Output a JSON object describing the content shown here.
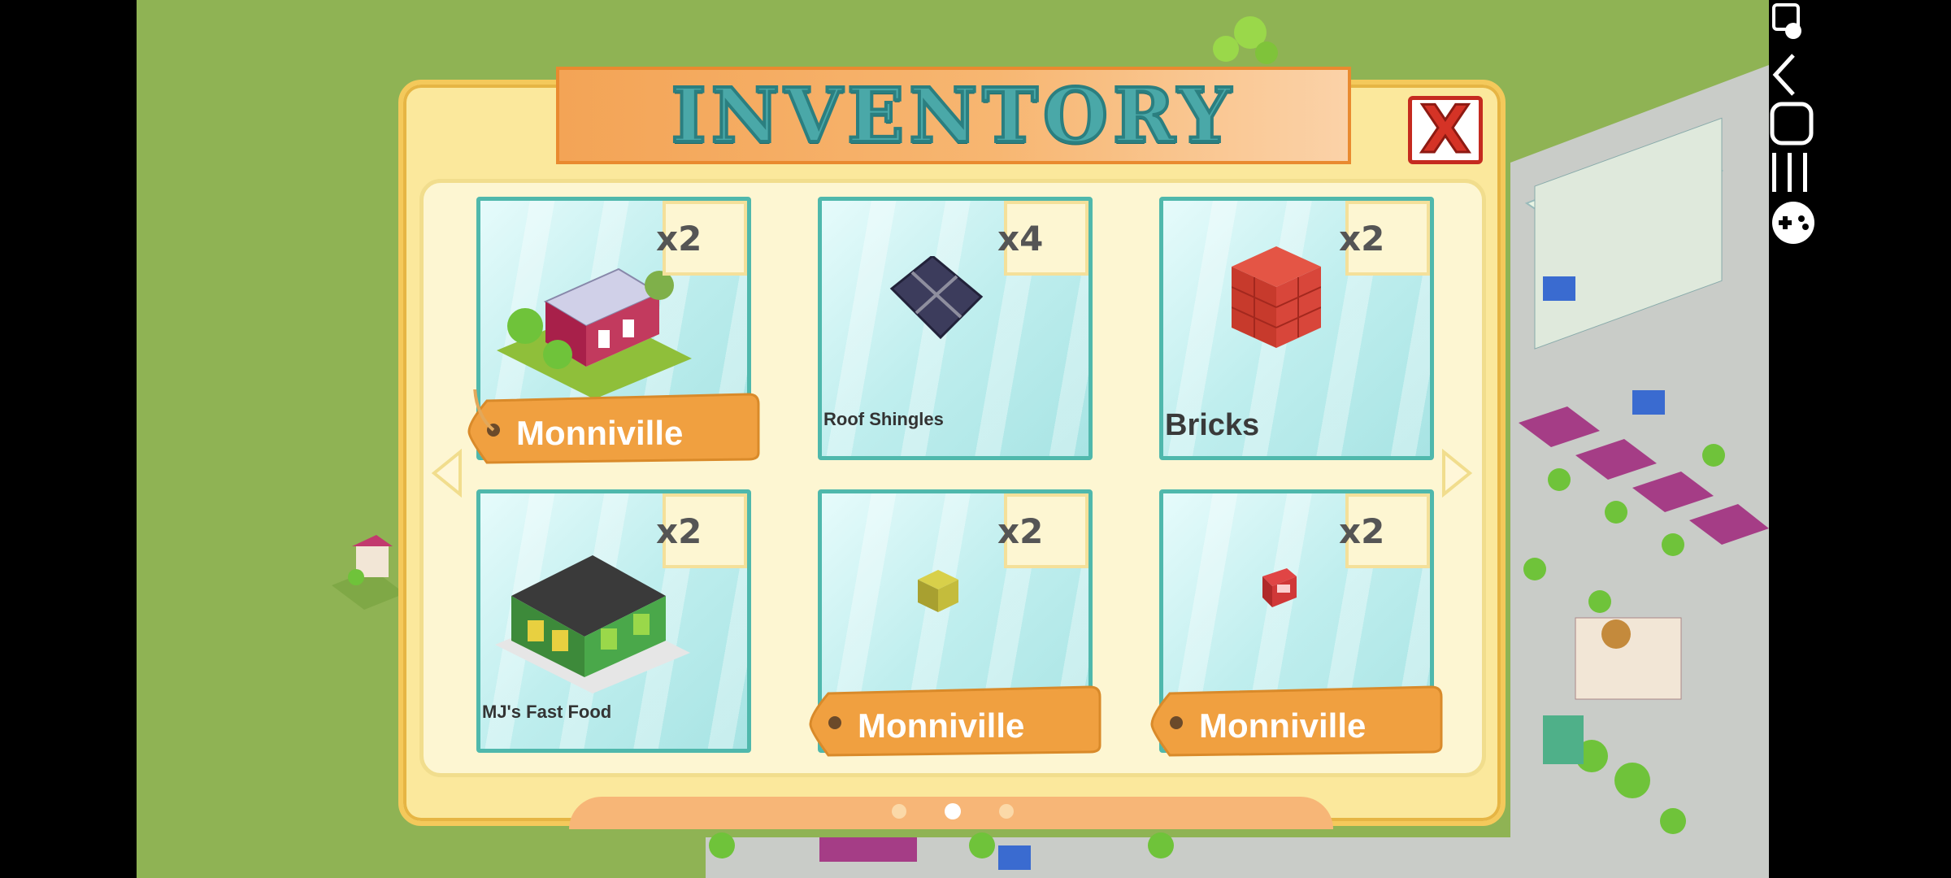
{
  "window": {
    "title": "INVENTORY"
  },
  "close_button": {
    "label": "X",
    "icon": "close-icon"
  },
  "grid": {
    "items": [
      {
        "name": "Monniville",
        "count": "x2",
        "label_style": "tag",
        "icon": "house-icon"
      },
      {
        "name": "Roof Shingles",
        "count": "x4",
        "label_style": "small",
        "icon": "roof-shingles-icon"
      },
      {
        "name": "Bricks",
        "count": "x2",
        "label_style": "big",
        "icon": "bricks-icon"
      },
      {
        "name": "MJ's Fast Food",
        "count": "x2",
        "label_style": "small",
        "icon": "fast-food-building-icon"
      },
      {
        "name": "Monniville",
        "count": "x2",
        "label_style": "tag",
        "icon": "yellow-crate-icon"
      },
      {
        "name": "Monniville",
        "count": "x2",
        "label_style": "tag",
        "icon": "red-box-icon"
      }
    ]
  },
  "pagination": {
    "pages": 3,
    "current": 2
  },
  "nav_icons": [
    "screenshot-touch-icon",
    "back-icon",
    "home-icon",
    "recents-icon",
    "game-controller-icon"
  ],
  "colors": {
    "tag": "#f0a040",
    "card_border": "#4fb8ac",
    "panel": "#fbe89c",
    "close": "#d53326",
    "title": "#4aa8a8"
  }
}
